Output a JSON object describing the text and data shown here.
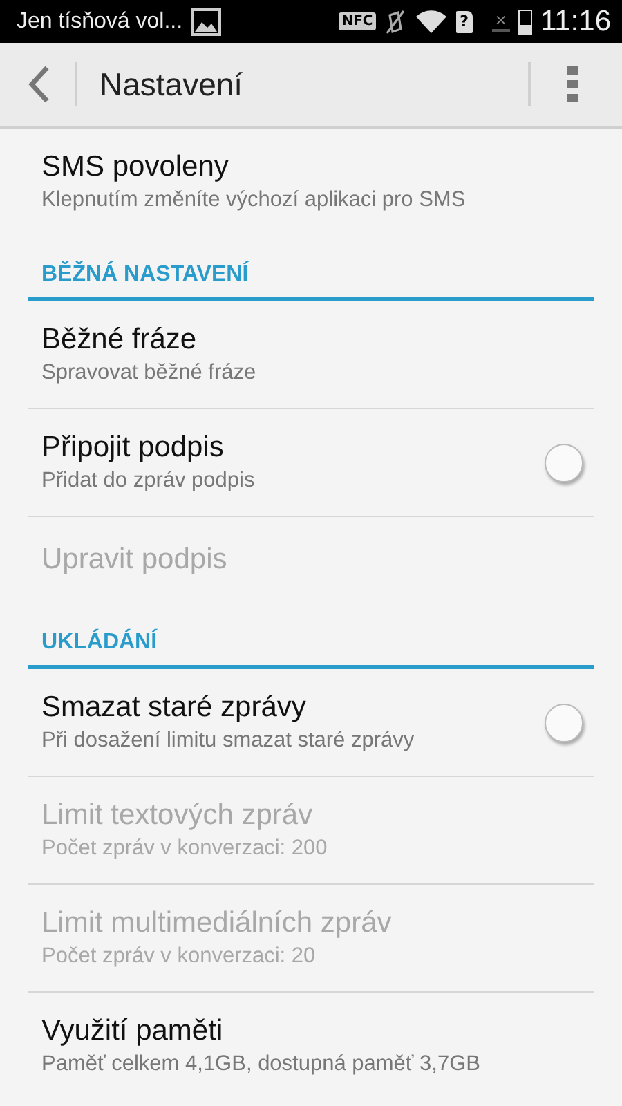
{
  "status_bar": {
    "notification": "Jen tísňová vol...",
    "nfc_label": "NFC",
    "sim_label": "?",
    "signal_x": "×",
    "time": "11:16"
  },
  "toolbar": {
    "title": "Nastavení"
  },
  "items": [
    {
      "kind": "item",
      "title": "SMS povoleny",
      "subtitle": "Klepnutím změníte výchozí aplikaci pro SMS",
      "disabled": false,
      "divider": false
    },
    {
      "kind": "section",
      "title": "BĚŽNÁ NASTAVENÍ"
    },
    {
      "kind": "item",
      "title": "Běžné fráze",
      "subtitle": "Spravovat běžné fráze",
      "disabled": false,
      "divider": true
    },
    {
      "kind": "toggle",
      "title": "Připojit podpis",
      "subtitle": "Přidat do zpráv podpis",
      "disabled": false,
      "checked": false,
      "divider": true
    },
    {
      "kind": "item",
      "title": "Upravit podpis",
      "disabled": true,
      "divider": false
    },
    {
      "kind": "section",
      "title": "UKLÁDÁNÍ"
    },
    {
      "kind": "toggle",
      "title": "Smazat staré zprávy",
      "subtitle": "Při dosažení limitu smazat staré zprávy",
      "disabled": false,
      "checked": false,
      "divider": true
    },
    {
      "kind": "item",
      "title": "Limit textových zpráv",
      "subtitle": "Počet zpráv v konverzaci: 200",
      "disabled": true,
      "divider": true
    },
    {
      "kind": "item",
      "title": "Limit multimediálních zpráv",
      "subtitle": "Počet zpráv v konverzaci: 20",
      "disabled": true,
      "divider": true
    },
    {
      "kind": "item",
      "title": "Využití paměti",
      "subtitle": "Paměť celkem 4,1GB, dostupná paměť 3,7GB",
      "disabled": false,
      "divider": false
    }
  ]
}
